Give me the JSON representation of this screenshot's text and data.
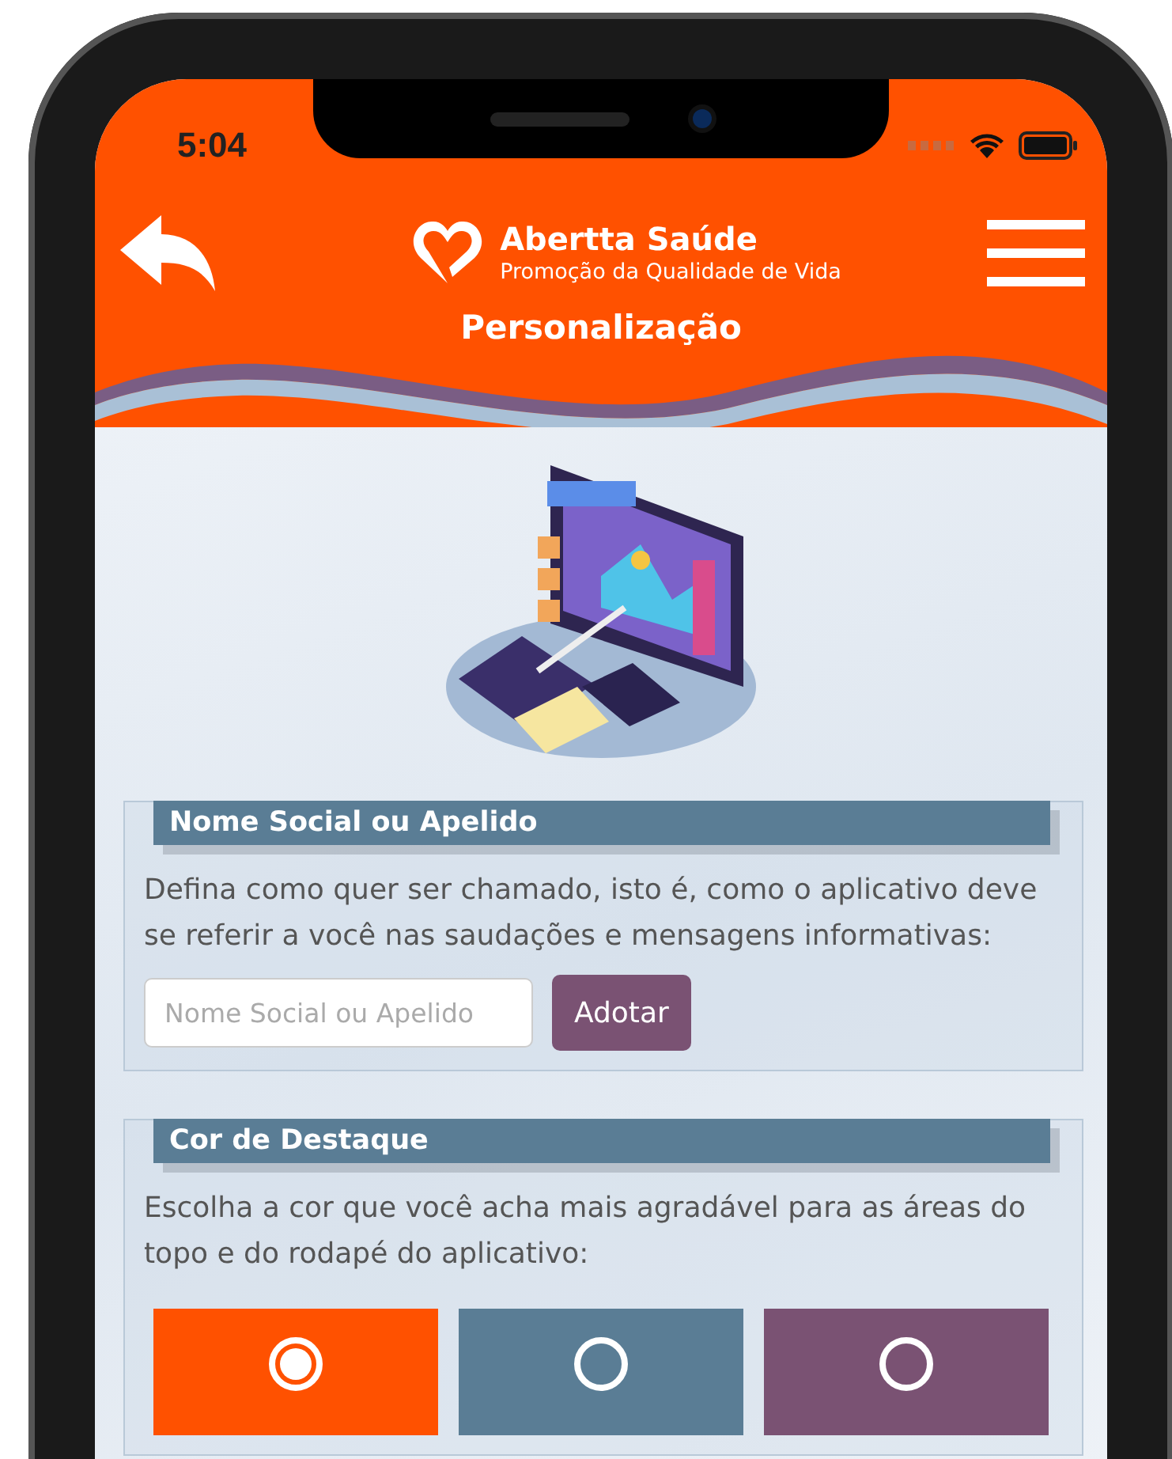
{
  "status_bar": {
    "time": "5:04"
  },
  "header": {
    "brand": "Abertta Saúde",
    "tagline": "Promoção da Qualidade de Vida",
    "title": "Personalização"
  },
  "nickname_section": {
    "heading": "Nome Social ou Apelido",
    "description": "Defina como quer ser chamado, isto é, como o aplicativo deve se referir a você nas saudações e mensagens informativas:",
    "field": {
      "placeholder": "Nome Social ou Apelido"
    },
    "button": "Adotar"
  },
  "color_section": {
    "heading": "Cor de Destaque",
    "description": "Escolha a cor que você acha mais agradável para as áreas do topo e do rodapé do aplicativo:",
    "swatches": [
      {
        "color": "#ff5100",
        "selected": true
      },
      {
        "color": "#5a7d95",
        "selected": false
      },
      {
        "color": "#7a5273",
        "selected": false
      }
    ]
  }
}
